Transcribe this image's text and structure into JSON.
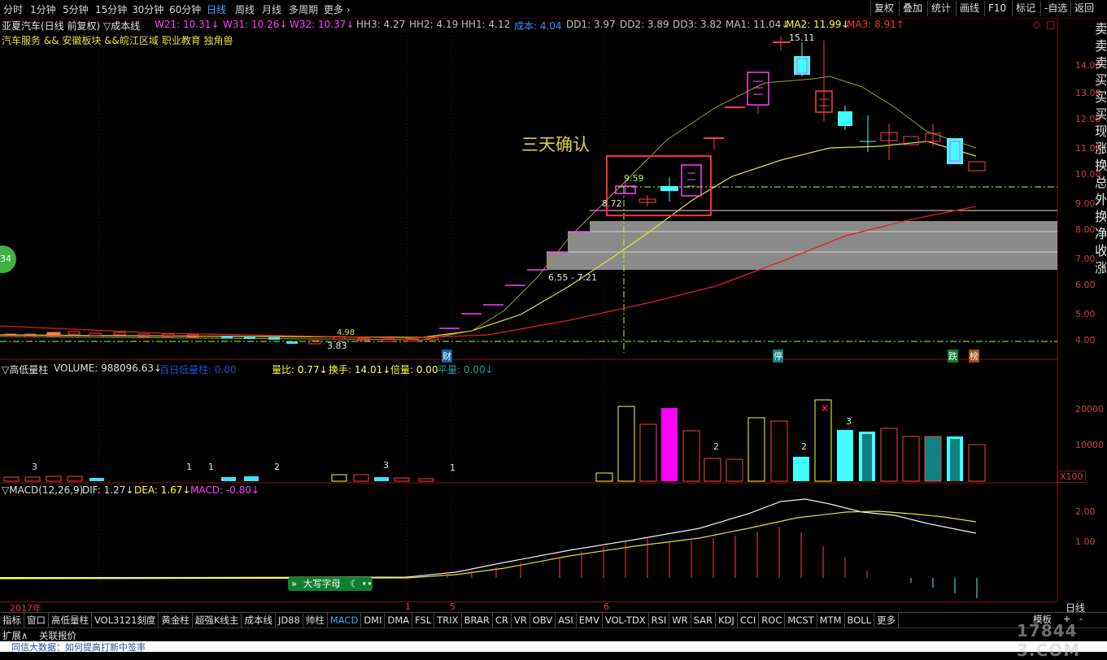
{
  "toolbar": {
    "timeframes": [
      "分时",
      "1分钟",
      "5分钟",
      "15分钟",
      "30分钟",
      "60分钟",
      "日线",
      "周线",
      "月线",
      "多周期",
      "更多 ›"
    ],
    "right_buttons": [
      "复权",
      "叠加",
      "统计",
      "画线",
      "F10",
      "标记",
      "-自选",
      "返回"
    ]
  },
  "header": {
    "title": "亚夏汽车(日线 前复权) ▽成本线",
    "w21": "W21: 10.31↓",
    "w31": "W31: 10.26↓",
    "w32": "W32: 10.37↓",
    "hh3": "HH3: 4.27",
    "hh2": "HH2: 4.19",
    "hh1": "HH1: 4.12",
    "cost": "成本: 4.04",
    "dd1": "DD1: 3.97",
    "dd2": "DD2: 3.89",
    "dd3": "DD3: 3.82",
    "ma1": "MA1: 11.04↓",
    "ma2": "MA2: 11.99↓",
    "ma3": "MA3: 8.91↑",
    "concepts": "汽车服务 && 安徽板块 &&皖江区域 职业教育 独角兽"
  },
  "annotations": {
    "three_days": "三天确认",
    "peak": "15.11",
    "p959": "9.59",
    "p872": "8.72",
    "range": "6.55 - 7.21",
    "low": "3.83",
    "p498": "4.98",
    "cai": "财",
    "ting": "停",
    "die": "跌",
    "bang": "榜",
    "badge": "34"
  },
  "price_scale": [
    "14.00",
    "13.00",
    "12.00",
    "11.00",
    "10.00",
    "9.00",
    "8.00",
    "7.00",
    "6.00",
    "5.00",
    "4.00"
  ],
  "volume_header": {
    "name": "▽高低量柱",
    "volume": "VOLUME: 988096.63↓",
    "ratio_bar": "百日低量柱: 0.00",
    "liangbi": "量比: 0.77↓",
    "huanshou": "换手: 14.01↓",
    "beiliang": "倍量: 0.00",
    "pingliang": "平量: 0.00↓"
  },
  "volume_scale": [
    "20000",
    "10000",
    "X100"
  ],
  "volume_labels": [
    "3",
    "1",
    "1",
    "2",
    "3",
    "1",
    "2",
    "2",
    "3"
  ],
  "macd_header": {
    "name": "▽MACD(12,26,9)",
    "dif": "DIF: 1.27↓",
    "dea": "DEA: 1.67↓",
    "macd": "MACD: -0.80↓"
  },
  "macd_scale": [
    "2.00",
    "1.00"
  ],
  "date_axis": {
    "year": "2017年",
    "m1": "1",
    "m5": "5",
    "m6": "6",
    "period": "日线"
  },
  "ime": {
    "label": "大写字母"
  },
  "indicator_tabs": [
    "指标",
    "窗口",
    "高低量柱",
    "VOL3121刻度",
    "黄金柱",
    "超强K线主",
    "成本线",
    "JD88",
    "帅柱",
    "MACD",
    "DMI",
    "DMA",
    "FSL",
    "TRIX",
    "BRAR",
    "CR",
    "VR",
    "OBV",
    "ASI",
    "EMV",
    "VOL-TDX",
    "RSI",
    "WR",
    "SAR",
    "KDJ",
    "CCI",
    "ROC",
    "MCST",
    "MTM",
    "BOLL",
    "更多"
  ],
  "selected_tab": "MACD",
  "bottom": {
    "expand": "扩展∧",
    "related": "关联报价",
    "template": "模板",
    "news": "同信大数据：如何提高打新中签率",
    "watermark": "17844​3.COM"
  },
  "right_side_text": "卖卖卖买买买现涨换总外换净收涨",
  "colors": {
    "up": "#ff4040",
    "down": "#40ffff",
    "ma1": "#e0e040",
    "ma3": "#ff2020",
    "volume_magenta": "#ff00ff"
  }
}
